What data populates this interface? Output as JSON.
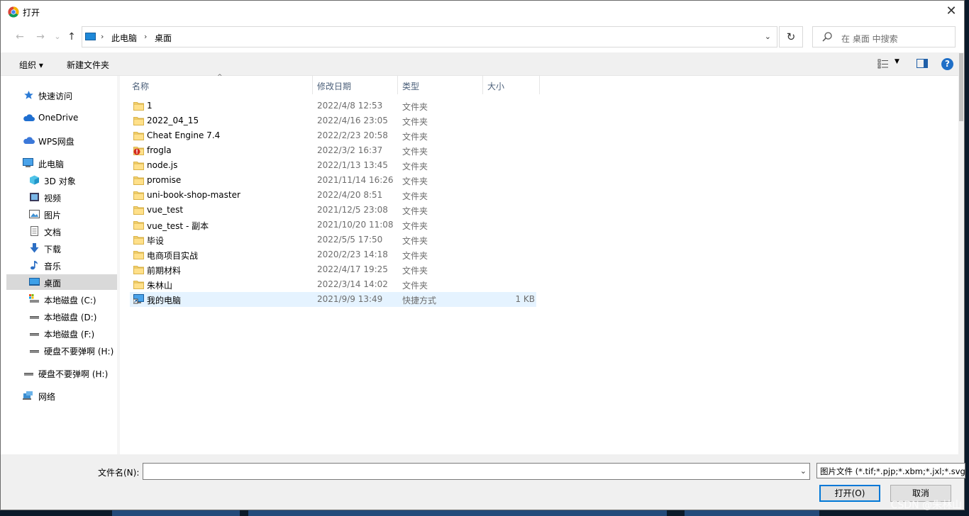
{
  "window": {
    "title": "打开",
    "close_glyph": "✕"
  },
  "nav": {
    "back_glyph": "←",
    "forward_glyph": "→",
    "recent_glyph": "⌄",
    "up_glyph": "↑",
    "breadcrumb": [
      "此电脑",
      "桌面"
    ],
    "breadcrumb_sep": "›",
    "dropdown_glyph": "⌄",
    "refresh_glyph": "↻",
    "search_placeholder": "在 桌面 中搜索"
  },
  "toolbar": {
    "organize": "组织 ▾",
    "new_folder": "新建文件夹",
    "view_dd": "▼",
    "help": "?"
  },
  "sidebar": {
    "items": [
      {
        "label": "快速访问",
        "icon": "star-icon"
      },
      {
        "label": "OneDrive",
        "icon": "cloud-icon"
      },
      {
        "label": "WPS网盘",
        "icon": "cloud-icon"
      },
      {
        "label": "此电脑",
        "icon": "computer-icon"
      },
      {
        "label": "3D 对象",
        "icon": "cube-icon"
      },
      {
        "label": "视频",
        "icon": "video-icon"
      },
      {
        "label": "图片",
        "icon": "picture-icon"
      },
      {
        "label": "文档",
        "icon": "document-icon"
      },
      {
        "label": "下载",
        "icon": "download-icon"
      },
      {
        "label": "音乐",
        "icon": "music-icon"
      },
      {
        "label": "桌面",
        "icon": "desktop-icon"
      },
      {
        "label": "本地磁盘 (C:)",
        "icon": "drive-icon"
      },
      {
        "label": "本地磁盘 (D:)",
        "icon": "drive-icon"
      },
      {
        "label": "本地磁盘 (F:)",
        "icon": "drive-icon"
      },
      {
        "label": "硬盘不要弹啊 (H:)",
        "icon": "drive-icon"
      },
      {
        "label": "硬盘不要弹啊 (H:)",
        "icon": "drive-icon"
      },
      {
        "label": "网络",
        "icon": "network-icon"
      }
    ]
  },
  "columns": {
    "name": "名称",
    "date": "修改日期",
    "type": "类型",
    "size": "大小",
    "sort_glyph": "^"
  },
  "files": [
    {
      "name": "1",
      "date": "2022/4/8 12:53",
      "type": "文件夹",
      "size": "",
      "icon": "folder-icon"
    },
    {
      "name": "2022_04_15",
      "date": "2022/4/16 23:05",
      "type": "文件夹",
      "size": "",
      "icon": "folder-icon"
    },
    {
      "name": "Cheat Engine 7.4",
      "date": "2022/2/23 20:58",
      "type": "文件夹",
      "size": "",
      "icon": "folder-icon"
    },
    {
      "name": "frogla",
      "date": "2022/3/2 16:37",
      "type": "文件夹",
      "size": "",
      "icon": "folder-error-icon"
    },
    {
      "name": "node.js",
      "date": "2022/1/13 13:45",
      "type": "文件夹",
      "size": "",
      "icon": "folder-icon"
    },
    {
      "name": "promise",
      "date": "2021/11/14 16:26",
      "type": "文件夹",
      "size": "",
      "icon": "folder-icon"
    },
    {
      "name": "uni-book-shop-master",
      "date": "2022/4/20 8:51",
      "type": "文件夹",
      "size": "",
      "icon": "folder-icon"
    },
    {
      "name": "vue_test",
      "date": "2021/12/5 23:08",
      "type": "文件夹",
      "size": "",
      "icon": "folder-icon"
    },
    {
      "name": "vue_test - 副本",
      "date": "2021/10/20 11:08",
      "type": "文件夹",
      "size": "",
      "icon": "folder-icon"
    },
    {
      "name": "毕设",
      "date": "2022/5/5 17:50",
      "type": "文件夹",
      "size": "",
      "icon": "folder-icon"
    },
    {
      "name": "电商项目实战",
      "date": "2020/2/23 14:18",
      "type": "文件夹",
      "size": "",
      "icon": "folder-icon"
    },
    {
      "name": "前期材料",
      "date": "2022/4/17 19:25",
      "type": "文件夹",
      "size": "",
      "icon": "folder-icon"
    },
    {
      "name": "朱林山",
      "date": "2022/3/14 14:02",
      "type": "文件夹",
      "size": "",
      "icon": "folder-icon"
    },
    {
      "name": "我的电脑",
      "date": "2021/9/9 13:49",
      "type": "快捷方式",
      "size": "1 KB",
      "icon": "shortcut-icon"
    }
  ],
  "bottom": {
    "filename_label": "文件名(N):",
    "filename_value": "",
    "dropdown_glyph": "⌄",
    "filter": "图片文件 (*.tif;*.pjp;*.xbm;*.jxl;*.svgz;*",
    "open_button": "打开(O)",
    "cancel_button": "取消"
  },
  "watermark": "CSDN @朱林山"
}
